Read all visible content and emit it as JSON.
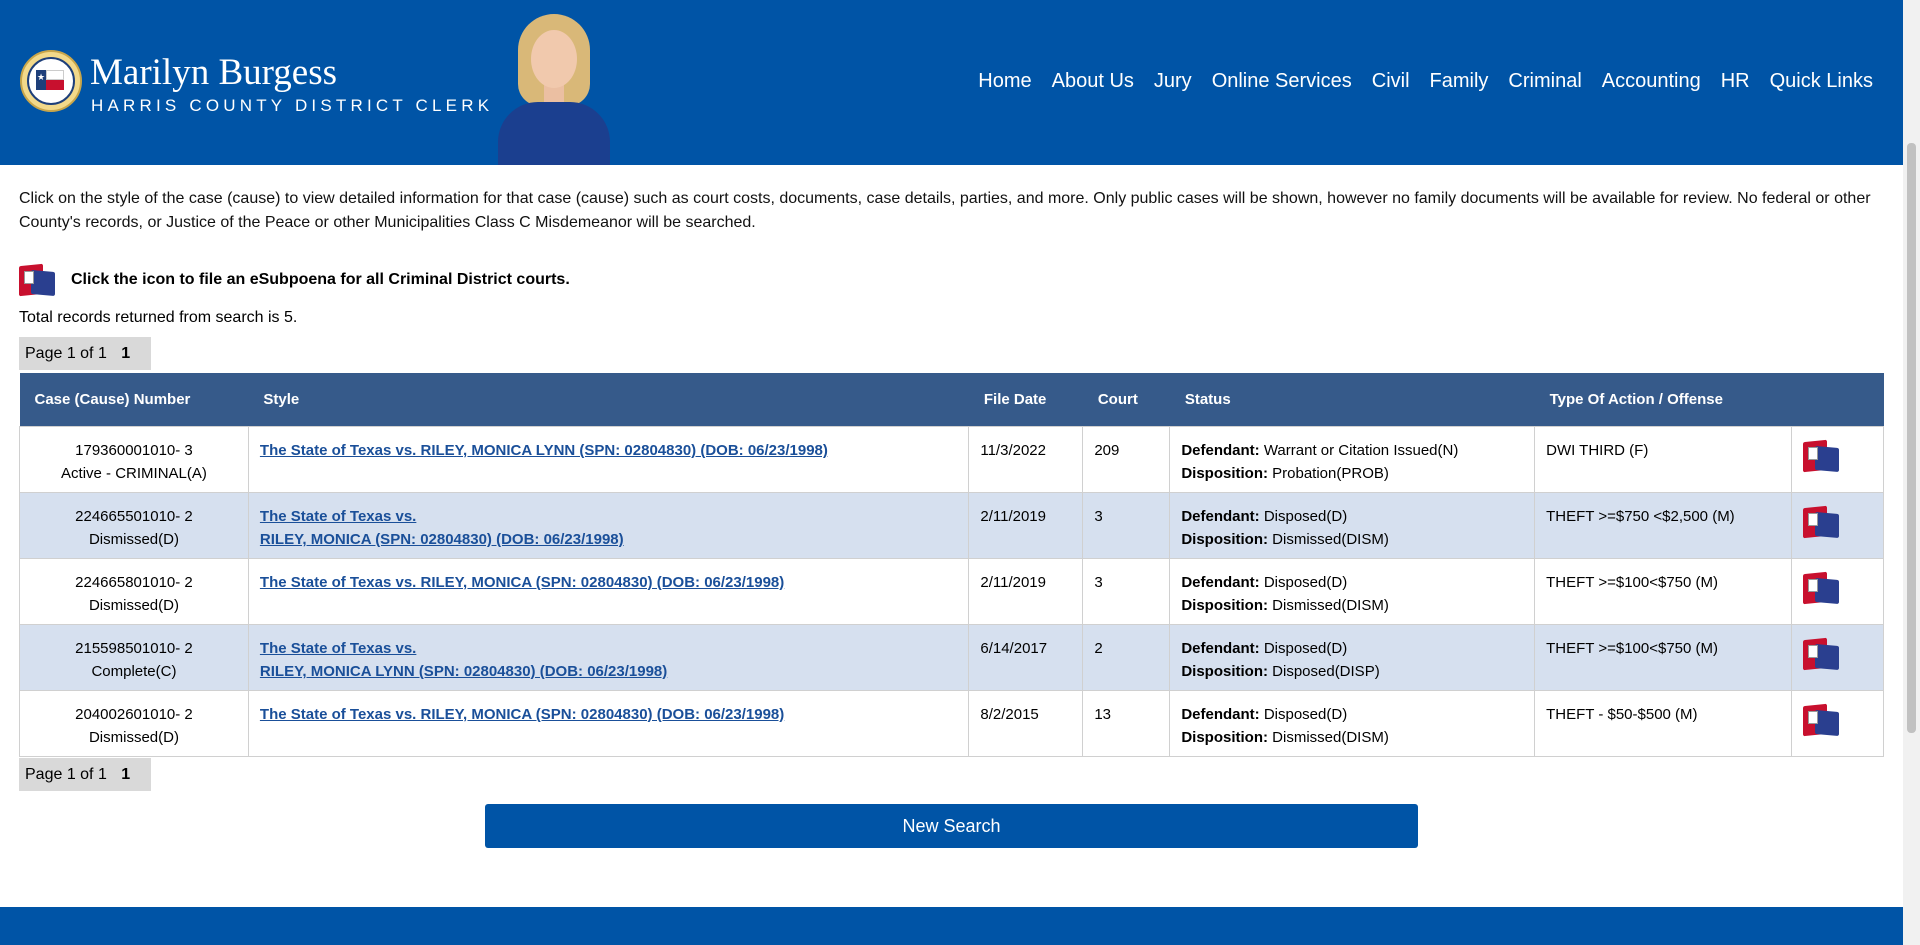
{
  "header": {
    "name": "Marilyn Burgess",
    "subtitle": "HARRIS COUNTY DISTRICT CLERK",
    "brand_color": "#0054a6",
    "nav": [
      "Home",
      "About Us",
      "Jury",
      "Online Services",
      "Civil",
      "Family",
      "Criminal",
      "Accounting",
      "HR",
      "Quick Links"
    ]
  },
  "intro": "Click on the style of the case (cause) to view detailed information for that case (cause) such as court costs, documents, case details, parties, and more. Only public cases will be shown, however no family documents will be available for review. No federal or other County's records, or Justice of the Peace or other Municipalities Class C Misdemeanor will be searched.",
  "esubpoena": {
    "text": "Click the icon to file an eSubpoena for all Criminal District courts.",
    "icon": "esubpoena-icon"
  },
  "total": "Total records returned from search is 5.",
  "pager": {
    "label": "Page 1 of 1",
    "current": "1"
  },
  "table": {
    "headers": [
      "Case (Cause) Number",
      "Style",
      "File Date",
      "Court",
      "Status",
      "Type Of Action / Offense",
      ""
    ],
    "defendant_label": "Defendant:",
    "disposition_label": "Disposition:",
    "rows": [
      {
        "case_number": "179360001010- 3",
        "case_status": "Active - CRIMINAL(A)",
        "style_line1": "The State of Texas vs. RILEY, MONICA LYNN (SPN: 02804830) (DOB: 06/23/1998)",
        "style_line2": "",
        "file_date": "11/3/2022",
        "court": "209",
        "defendant": "Warrant or Citation Issued(N)",
        "disposition": "Probation(PROB)",
        "offense": "DWI THIRD (F)"
      },
      {
        "case_number": "224665501010- 2",
        "case_status": "Dismissed(D)",
        "style_line1": "The State of Texas vs. ",
        "style_line2": "RILEY, MONICA (SPN: 02804830) (DOB: 06/23/1998)",
        "file_date": "2/11/2019",
        "court": "3",
        "defendant": "Disposed(D)",
        "disposition": "Dismissed(DISM)",
        "offense": "THEFT >=$750 <$2,500 (M)"
      },
      {
        "case_number": "224665801010- 2",
        "case_status": "Dismissed(D)",
        "style_line1": "The State of Texas vs. RILEY, MONICA (SPN: 02804830) (DOB: 06/23/1998)",
        "style_line2": "",
        "file_date": "2/11/2019",
        "court": "3",
        "defendant": "Disposed(D)",
        "disposition": "Dismissed(DISM)",
        "offense": "THEFT >=$100<$750 (M)"
      },
      {
        "case_number": "215598501010- 2",
        "case_status": "Complete(C)",
        "style_line1": "The State of Texas vs. ",
        "style_line2": "RILEY, MONICA LYNN (SPN: 02804830) (DOB: 06/23/1998)",
        "file_date": "6/14/2017",
        "court": "2",
        "defendant": "Disposed(D)",
        "disposition": "Disposed(DISP)",
        "offense": "THEFT >=$100<$750 (M)"
      },
      {
        "case_number": "204002601010- 2",
        "case_status": "Dismissed(D)",
        "style_line1": "The State of Texas vs. RILEY, MONICA (SPN: 02804830) (DOB: 06/23/1998)",
        "style_line2": "",
        "file_date": "8/2/2015",
        "court": "13",
        "defendant": "Disposed(D)",
        "disposition": "Dismissed(DISM)",
        "offense": "THEFT - $50-$500 (M)"
      }
    ]
  },
  "new_search_label": "New Search"
}
